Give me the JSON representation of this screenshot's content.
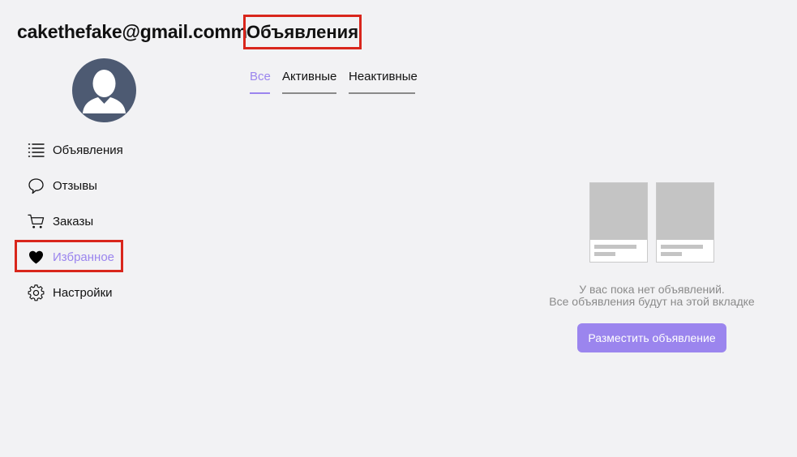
{
  "user": {
    "email": "cakethefake@gmail.comm"
  },
  "header": {
    "title": "Объявления"
  },
  "sidebar": {
    "items": [
      {
        "label": "Объявления",
        "icon": "list-icon"
      },
      {
        "label": "Отзывы",
        "icon": "speech-bubble-icon"
      },
      {
        "label": "Заказы",
        "icon": "cart-icon"
      },
      {
        "label": "Избранное",
        "icon": "heart-icon",
        "active": true
      },
      {
        "label": "Настройки",
        "icon": "gear-icon"
      }
    ]
  },
  "tabs": [
    {
      "label": "Все",
      "active": true
    },
    {
      "label": "Активные"
    },
    {
      "label": "Неактивные"
    }
  ],
  "empty_state": {
    "line1": "У вас пока нет объявлений.",
    "line2": "Все объявления будут на этой вкладке",
    "button_label": "Разместить объявление"
  },
  "colors": {
    "accent": "#9b85ee",
    "highlight": "#d9261c",
    "avatar_bg": "#4d5a72",
    "background": "#f2f2f4"
  }
}
